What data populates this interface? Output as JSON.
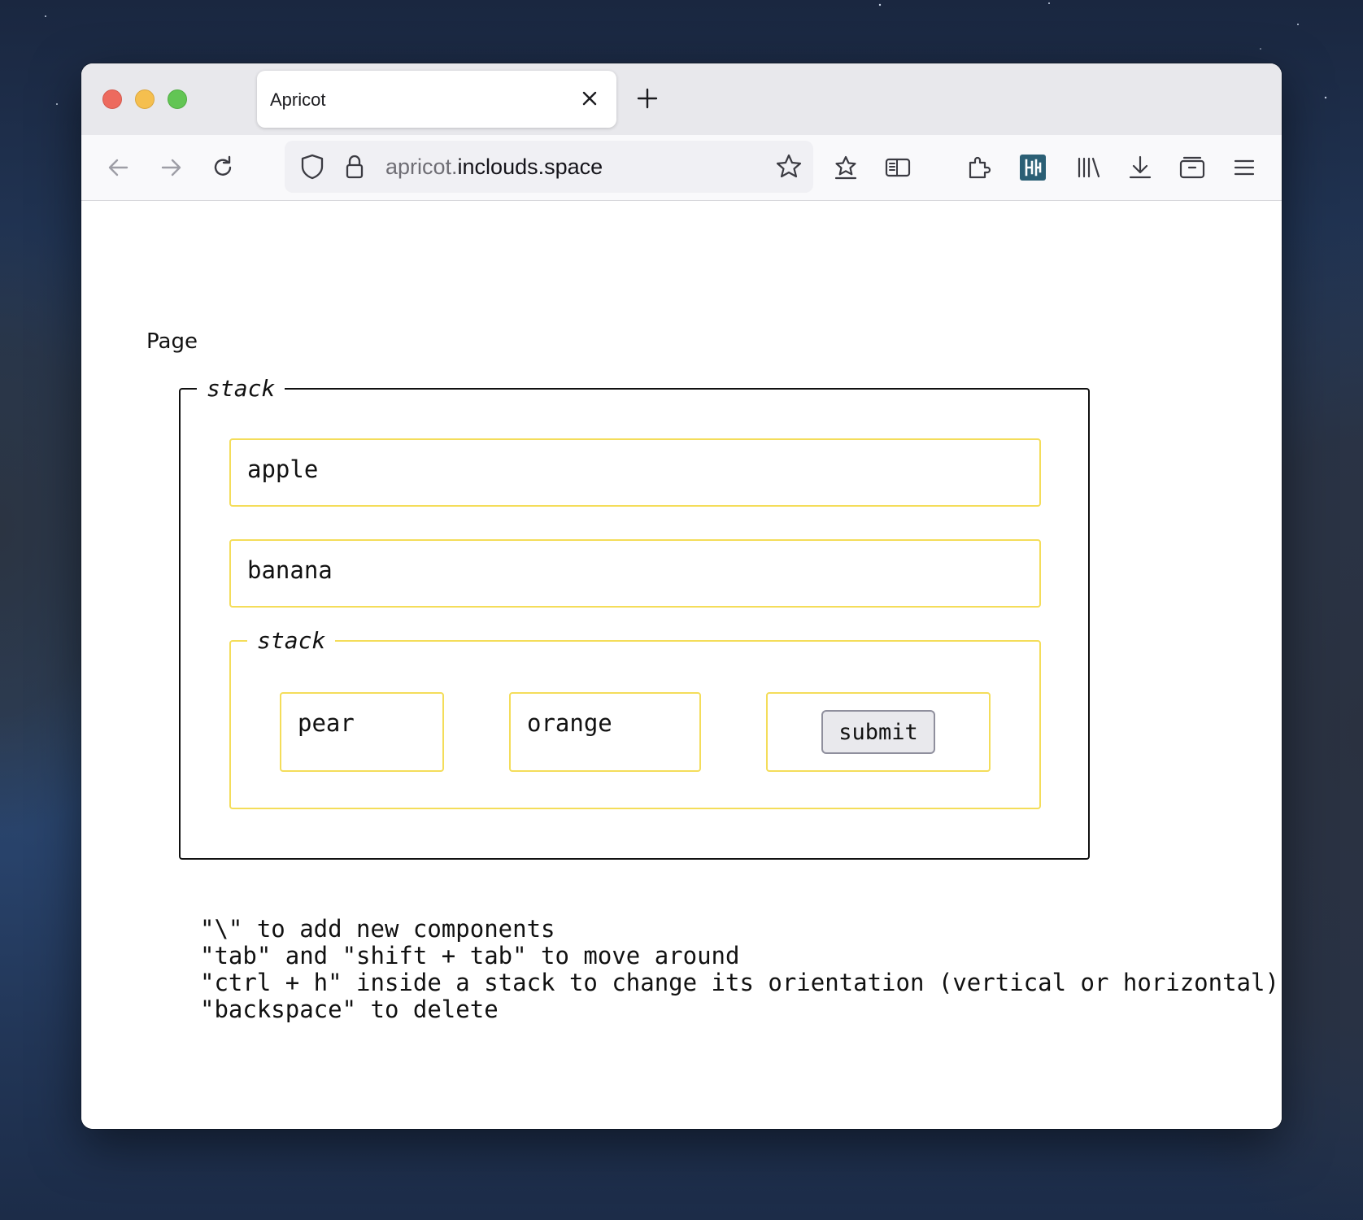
{
  "browser": {
    "tab_title": "Apricot",
    "url_host_prefix": "apricot.",
    "url_host_main": "inclouds.space"
  },
  "icons": {
    "back": "arrow-left-icon",
    "forward": "arrow-right-icon",
    "reload": "reload-icon",
    "shield": "shield-icon",
    "lock": "lock-icon",
    "bookmark": "star-icon",
    "pocket": "star-outline-box-icon",
    "reader": "reader-view-icon",
    "extensions": "puzzle-icon",
    "extension_app": "app-extension-icon",
    "library": "library-icon",
    "downloads": "download-icon",
    "containers": "container-icon",
    "menu": "hamburger-menu-icon"
  },
  "colors": {
    "stack_border": "#111111",
    "component_border": "#f4dd5a",
    "extension_accent": "#2b5f75"
  },
  "page": {
    "label": "Page",
    "outer_stack": {
      "legend": "stack",
      "items": [
        "apple",
        "banana"
      ],
      "inner_stack": {
        "legend": "stack",
        "items": [
          "pear",
          "orange"
        ],
        "submit_label": "submit"
      }
    },
    "help": [
      "\"\\\" to add new components",
      "\"tab\" and \"shift + tab\" to move around",
      "\"ctrl + h\" inside a stack to change its orientation (vertical or horizontal)",
      "\"backspace\" to delete"
    ]
  }
}
